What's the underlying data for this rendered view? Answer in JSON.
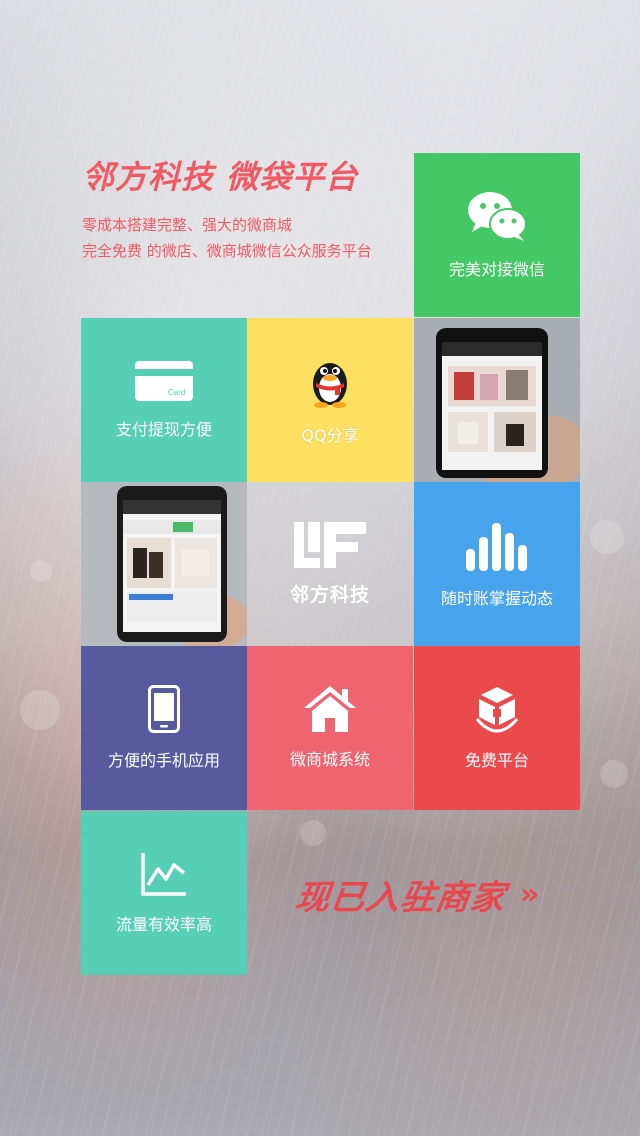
{
  "header": {
    "title": "邻方科技 微袋平台",
    "line1": "零成本搭建完整、强大的微商城",
    "line2": "完全免费 的微店、微商城微信公众服务平台"
  },
  "tiles": {
    "wechat": {
      "label": "完美对接微信",
      "icon": "wechat-icon",
      "color": "#43c865"
    },
    "pay": {
      "label": "支付提现方便",
      "icon": "card-icon",
      "card_text": "Card",
      "color": "#57cfb6"
    },
    "qq": {
      "label": "QQ分享",
      "icon": "qq-penguin-icon",
      "color": "#fde062"
    },
    "logo": {
      "label": "邻方科技",
      "icon": "lf-logo-icon"
    },
    "stats": {
      "label": "随时账掌握动态",
      "icon": "bar-chart-icon",
      "color": "#48a3ed"
    },
    "mobile": {
      "label": "方便的手机应用",
      "icon": "smartphone-icon",
      "color": "#575b9e"
    },
    "mall": {
      "label": "微商城系统",
      "icon": "house-icon",
      "color": "#ee6470"
    },
    "free": {
      "label": "免费平台",
      "icon": "gift-box-icon",
      "color": "#eb4a4c"
    },
    "traffic": {
      "label": "流量有效率高",
      "icon": "line-chart-icon",
      "color": "#57cfb6"
    }
  },
  "cta": {
    "label": "现已入驻商家",
    "arrow": "»"
  }
}
